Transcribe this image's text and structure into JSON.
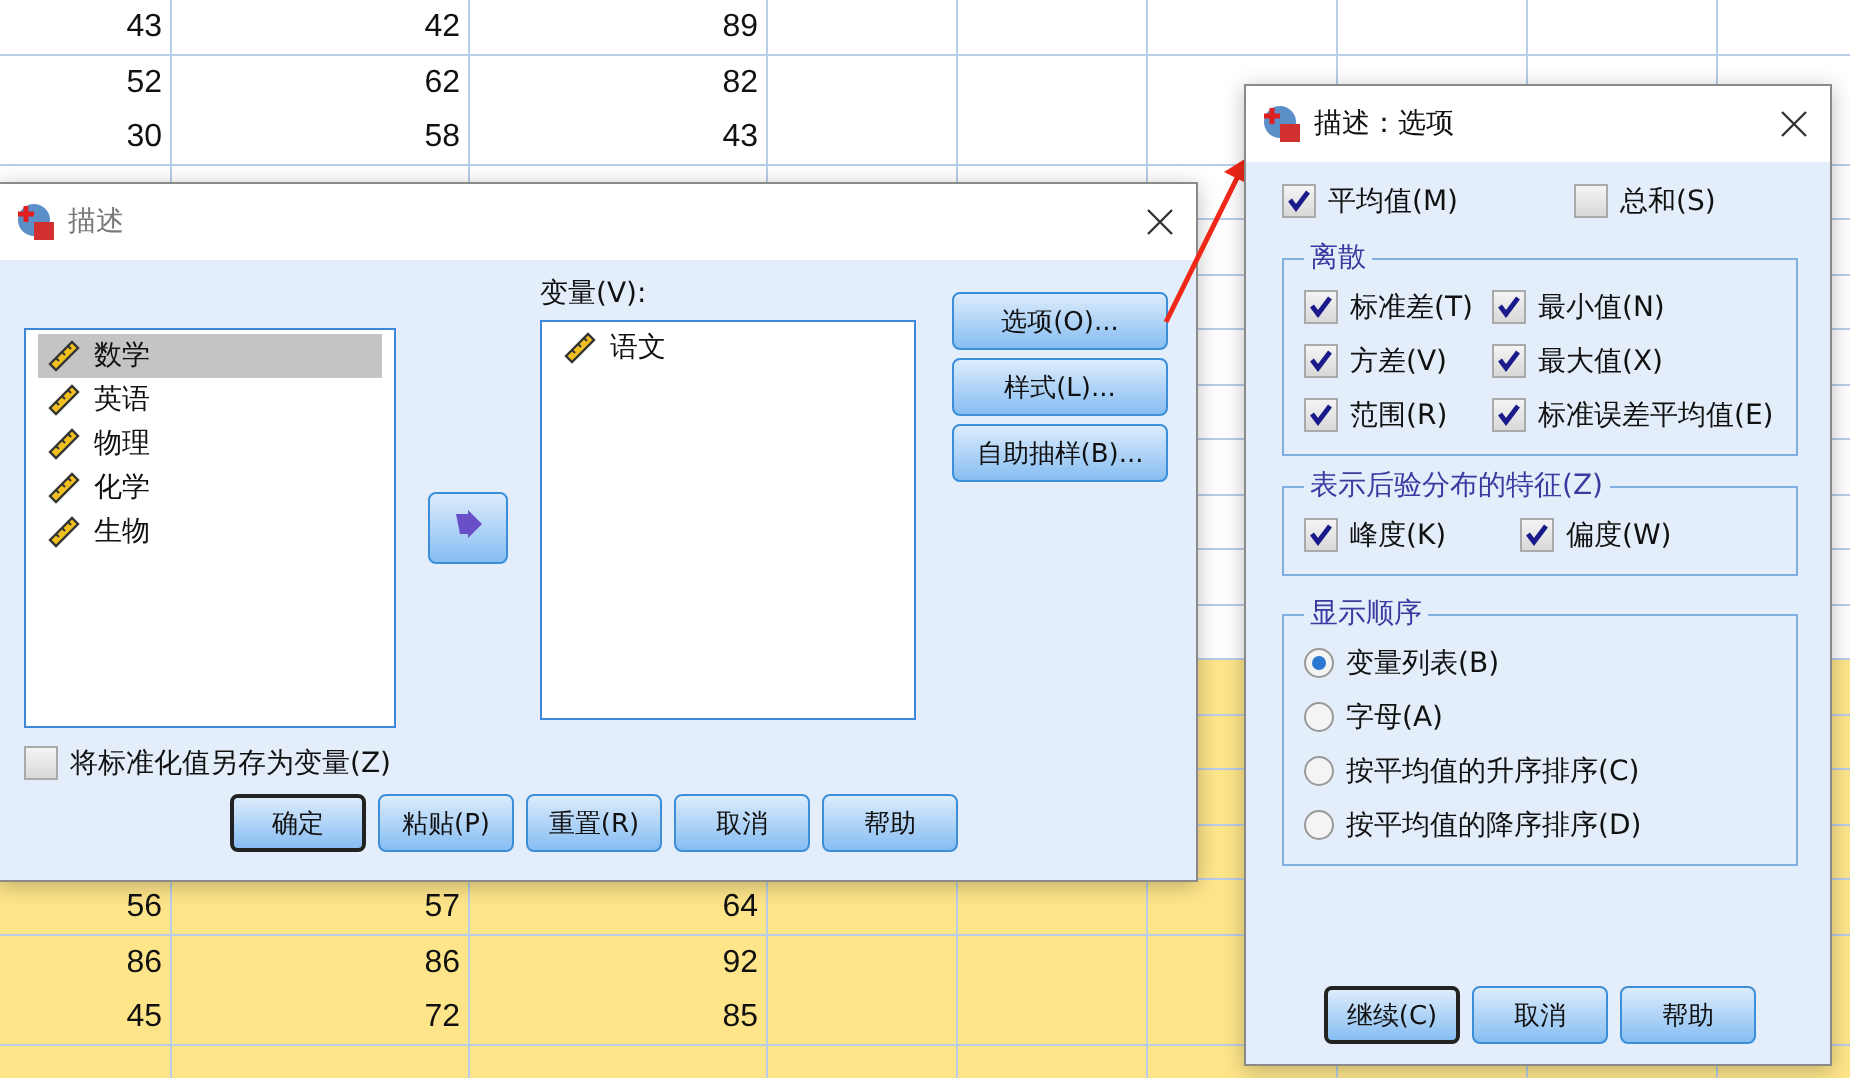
{
  "sheet": {
    "rows": [
      {
        "cells": [
          "43",
          "42",
          "89"
        ],
        "highlighted": false
      },
      {
        "cells": [
          "52",
          "62",
          "82"
        ],
        "highlighted": false
      },
      {
        "cells": [
          "30",
          "58",
          "43"
        ],
        "highlighted": false
      },
      {
        "cells": [
          "56",
          "57",
          "64"
        ],
        "highlighted": true
      },
      {
        "cells": [
          "86",
          "86",
          "92"
        ],
        "highlighted": true
      },
      {
        "cells": [
          "45",
          "72",
          "85"
        ],
        "highlighted": true
      }
    ]
  },
  "describe_dialog": {
    "title": "描述",
    "source_list": [
      {
        "label": "数学",
        "selected": true
      },
      {
        "label": "英语",
        "selected": false
      },
      {
        "label": "物理",
        "selected": false
      },
      {
        "label": "化学",
        "selected": false
      },
      {
        "label": "生物",
        "selected": false
      }
    ],
    "variables_label": "变量(V):",
    "variables": [
      {
        "label": "语文",
        "selected": false
      }
    ],
    "side_buttons": [
      "选项(O)...",
      "样式(L)...",
      "自助抽样(B)..."
    ],
    "save_checkbox": {
      "label": "将标准化值另存为变量(Z)",
      "checked": false
    },
    "buttons": [
      {
        "label": "确定",
        "default": true
      },
      {
        "label": "粘贴(P)",
        "default": false
      },
      {
        "label": "重置(R)",
        "default": false
      },
      {
        "label": "取消",
        "default": false
      },
      {
        "label": "帮助",
        "default": false
      }
    ]
  },
  "options_dialog": {
    "title": "描述：选项",
    "top": [
      {
        "label": "平均值(M)",
        "checked": true
      },
      {
        "label": "总和(S)",
        "checked": false
      }
    ],
    "dispersion": {
      "title": "离散",
      "items": [
        {
          "label": "标准差(T)",
          "checked": true
        },
        {
          "label": "最小值(N)",
          "checked": true
        },
        {
          "label": "方差(V)",
          "checked": true
        },
        {
          "label": "最大值(X)",
          "checked": true
        },
        {
          "label": "范围(R)",
          "checked": true
        },
        {
          "label": "标准误差平均值(E)",
          "checked": true
        }
      ]
    },
    "posterior": {
      "title": "表示后验分布的特征(Z)",
      "items": [
        {
          "label": "峰度(K)",
          "checked": true
        },
        {
          "label": "偏度(W)",
          "checked": true
        }
      ]
    },
    "display_order": {
      "title": "显示顺序",
      "options": [
        {
          "label": "变量列表(B)",
          "selected": true
        },
        {
          "label": "字母(A)",
          "selected": false
        },
        {
          "label": "按平均值的升序排序(C)",
          "selected": false
        },
        {
          "label": "按平均值的降序排序(D)",
          "selected": false
        }
      ]
    },
    "buttons": [
      {
        "label": "继续(C)",
        "default": true
      },
      {
        "label": "取消",
        "default": false
      },
      {
        "label": "帮助",
        "default": false
      }
    ]
  }
}
